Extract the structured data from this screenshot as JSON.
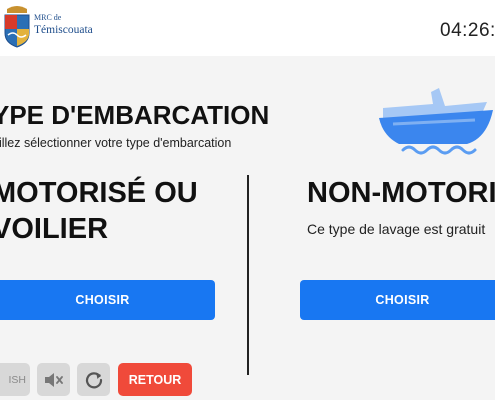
{
  "header": {
    "logo": {
      "line1": "MRC de",
      "line2": "Témiscouata"
    },
    "clock": "04:26:"
  },
  "page": {
    "title": "YPE D'EMBARCATION",
    "subtitle": "uillez sélectionner votre type d'embarcation"
  },
  "options": [
    {
      "title": "MOTORISÉ OU VOILIER",
      "description": "",
      "button_label": "CHOISIR"
    },
    {
      "title": "NON-MOTORI",
      "description": "Ce type de lavage est gratuit",
      "button_label": "CHOISIR"
    }
  ],
  "footer": {
    "language_label": "ISH",
    "mute_icon": "mute-icon",
    "refresh_icon": "refresh-icon",
    "back_label": "RETOUR"
  },
  "colors": {
    "primary_button": "#1877f2",
    "back_button": "#f04a3a",
    "boat_light": "#a6c8f5",
    "boat_dark": "#3b86ee"
  }
}
